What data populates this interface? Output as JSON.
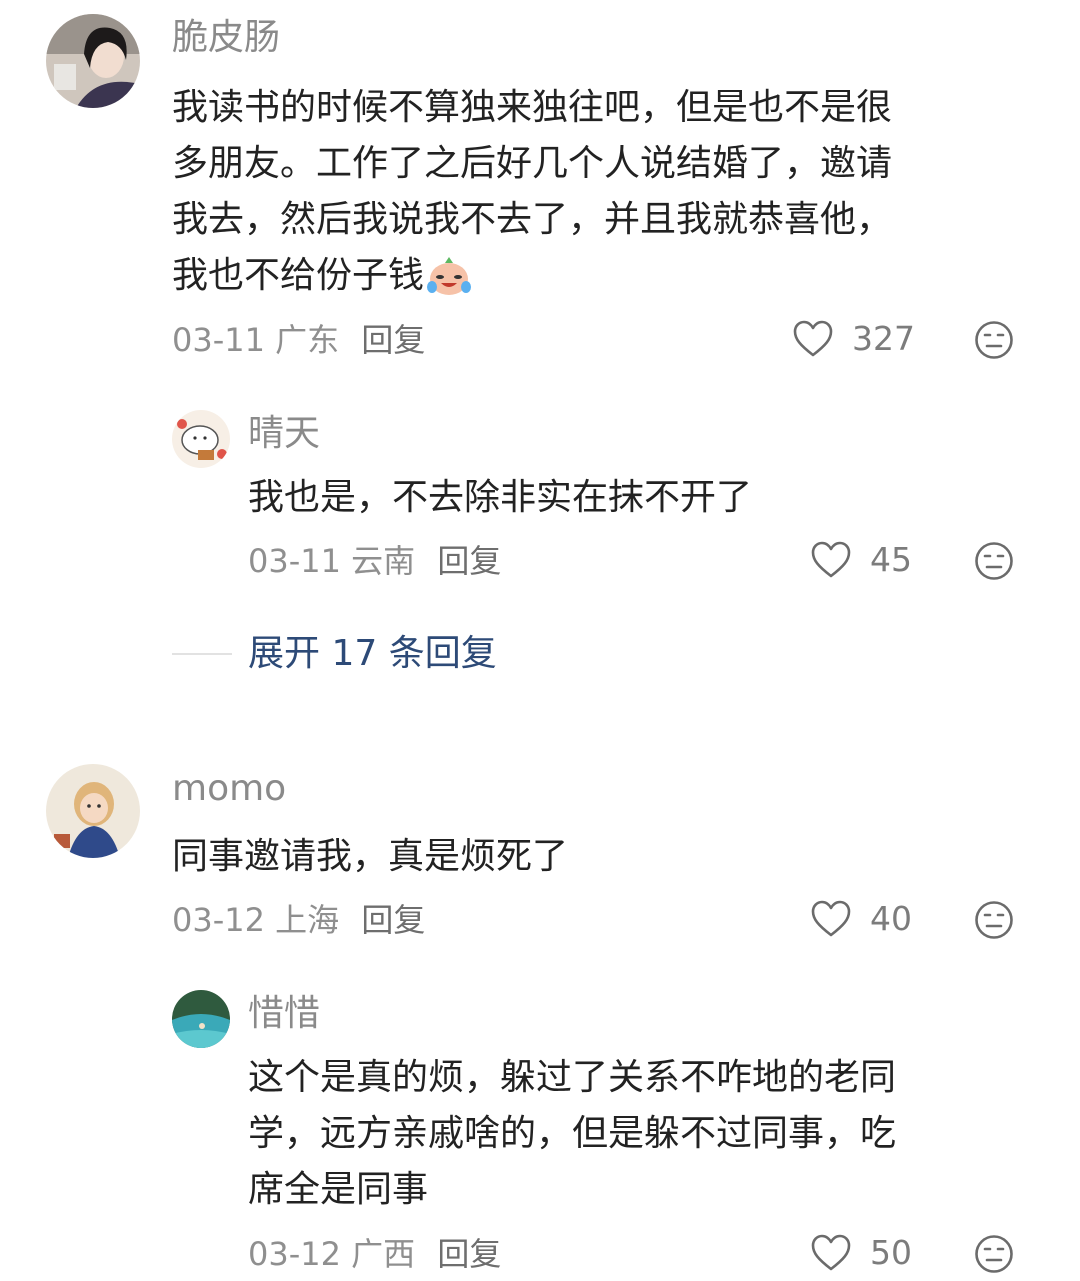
{
  "comments": [
    {
      "username": "脆皮肠",
      "lines": [
        "我读书的时候不算独来独往吧，但是也不是很",
        "多朋友。工作了之后好几个人说结婚了，邀请",
        "我去，然后我说我不去了，并且我就恭喜他，",
        "我也不给份子钱"
      ],
      "emoji": "crying-laughing-emoji",
      "date": "03-11",
      "location": "广东",
      "reply_label": "回复",
      "likes": "327",
      "replies": [
        {
          "username": "晴天",
          "lines": [
            "我也是，不去除非实在抹不开了"
          ],
          "date": "03-11",
          "location": "云南",
          "reply_label": "回复",
          "likes": "45"
        }
      ],
      "expand_label": "展开 17 条回复"
    },
    {
      "username": "momo",
      "lines": [
        "同事邀请我，真是烦死了"
      ],
      "date": "03-12",
      "location": "上海",
      "reply_label": "回复",
      "likes": "40",
      "replies": [
        {
          "username": "惜惜",
          "lines": [
            "这个是真的烦，躲过了关系不咋地的老同",
            "学，远方亲戚啥的，但是躲不过同事，吃",
            "席全是同事"
          ],
          "date": "03-12",
          "location": "广西",
          "reply_label": "回复",
          "likes": "50"
        }
      ]
    }
  ],
  "icons": {
    "like": "heart-outline-icon",
    "react": "neutral-face-icon"
  },
  "colors": {
    "link": "#2d4a77",
    "text": "#222222",
    "muted": "#8a8a8a"
  }
}
